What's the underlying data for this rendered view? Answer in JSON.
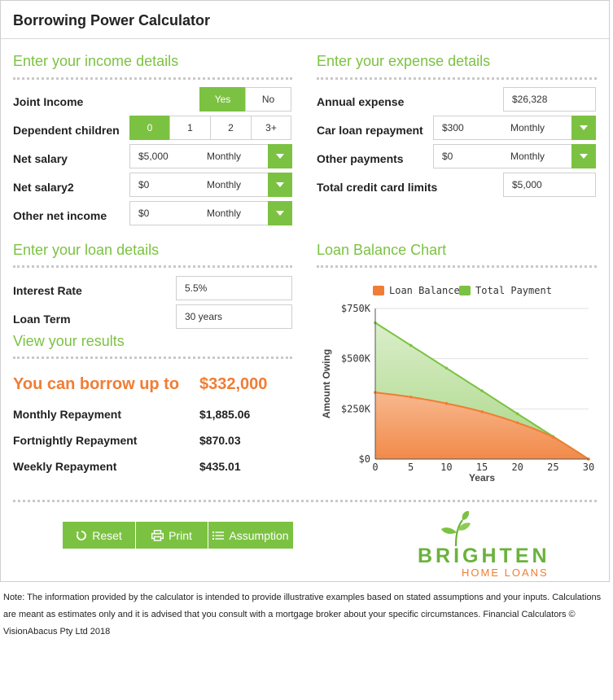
{
  "title": "Borrowing Power Calculator",
  "income": {
    "heading": "Enter your income details",
    "joint": {
      "label": "Joint Income",
      "options": [
        "Yes",
        "No"
      ],
      "selected": "Yes"
    },
    "dependents": {
      "label": "Dependent children",
      "options": [
        "0",
        "1",
        "2",
        "3+"
      ],
      "selected": "0"
    },
    "net_salary": {
      "label": "Net salary",
      "value": "$5,000",
      "freq": "Monthly"
    },
    "net_salary2": {
      "label": "Net salary2",
      "value": "$0",
      "freq": "Monthly"
    },
    "other_income": {
      "label": "Other net income",
      "value": "$0",
      "freq": "Monthly"
    }
  },
  "expense": {
    "heading": "Enter your expense details",
    "annual": {
      "label": "Annual expense",
      "value": "$26,328"
    },
    "car_loan": {
      "label": "Car loan repayment",
      "value": "$300",
      "freq": "Monthly"
    },
    "other_payments": {
      "label": "Other payments",
      "value": "$0",
      "freq": "Monthly"
    },
    "credit_limits": {
      "label": "Total credit card limits",
      "value": "$5,000"
    }
  },
  "loan": {
    "heading": "Enter your loan details",
    "interest": {
      "label": "Interest Rate",
      "value": "5.5%"
    },
    "term": {
      "label": "Loan Term",
      "value": "30 years"
    }
  },
  "results": {
    "heading": "View your results",
    "borrow_label": "You can borrow up to",
    "borrow_value": "$332,000",
    "rows": [
      {
        "label": "Monthly Repayment",
        "value": "$1,885.06"
      },
      {
        "label": "Fortnightly Repayment",
        "value": "$870.03"
      },
      {
        "label": "Weekly Repayment",
        "value": "$435.01"
      }
    ]
  },
  "chart_section": {
    "heading": "Loan Balance Chart"
  },
  "chart_data": {
    "type": "area",
    "title": "",
    "xlabel": "Years",
    "ylabel": "Amount Owing",
    "x_ticks": [
      0,
      5,
      10,
      15,
      20,
      25,
      30
    ],
    "y_ticks": [
      0,
      250000,
      500000,
      750000
    ],
    "y_tick_labels": [
      "$0",
      "$250K",
      "$500K",
      "$750K"
    ],
    "xlim": [
      0,
      30
    ],
    "ylim": [
      0,
      750000
    ],
    "grid": "horizontal",
    "legend_position": "top",
    "x": [
      0,
      5,
      10,
      15,
      20,
      25,
      30
    ],
    "series": [
      {
        "name": "Loan Balance",
        "color": "#f07d35",
        "values": [
          332000,
          309000,
          277000,
          236000,
          181000,
          109000,
          0
        ]
      },
      {
        "name": "Total Payment",
        "color": "#7cc242",
        "values": [
          679000,
          566000,
          453000,
          340000,
          226000,
          113000,
          0
        ]
      }
    ]
  },
  "buttons": {
    "reset": "Reset",
    "print": "Print",
    "assumption": "Assumption"
  },
  "logo": {
    "word": "BRIGHTEN",
    "sub": "HOME LOANS"
  },
  "footer_note": "Note: The information provided by the calculator is intended to provide illustrative examples based on stated assumptions and your inputs. Calculations are meant as estimates only and it is advised that you consult with a mortgage broker about your specific circumstances. Financial Calculators © VisionAbacus Pty Ltd 2018"
}
